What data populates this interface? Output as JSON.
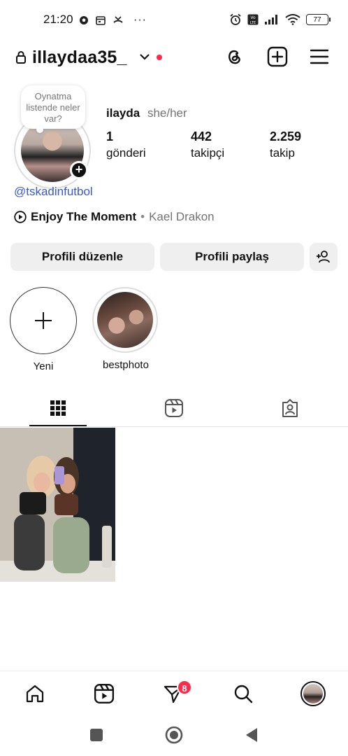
{
  "status_bar": {
    "time": "21:20",
    "battery": "77",
    "more": "···"
  },
  "header": {
    "username": "illaydaa35_"
  },
  "profile": {
    "note_bubble": "Oynatma listende neler var?",
    "display_name": "ilayda",
    "pronouns": "she/her",
    "stats": [
      {
        "value": "1",
        "label": "gönderi"
      },
      {
        "value": "442",
        "label": "takipçi"
      },
      {
        "value": "2.259",
        "label": "takip"
      }
    ],
    "threads_link": "@tskadinfutbol",
    "music": {
      "title": "Enjoy The Moment",
      "separator": "•",
      "artist": "Kael Drakon"
    }
  },
  "actions": {
    "edit_profile": "Profili düzenle",
    "share_profile": "Profili paylaş"
  },
  "highlights": [
    {
      "label": "Yeni"
    },
    {
      "label": "bestphoto"
    }
  ],
  "bottom_nav": {
    "dm_badge": "8"
  },
  "colors": {
    "link": "#3a58c9",
    "badge": "#ff2a4a",
    "button_bg": "#efefef"
  }
}
